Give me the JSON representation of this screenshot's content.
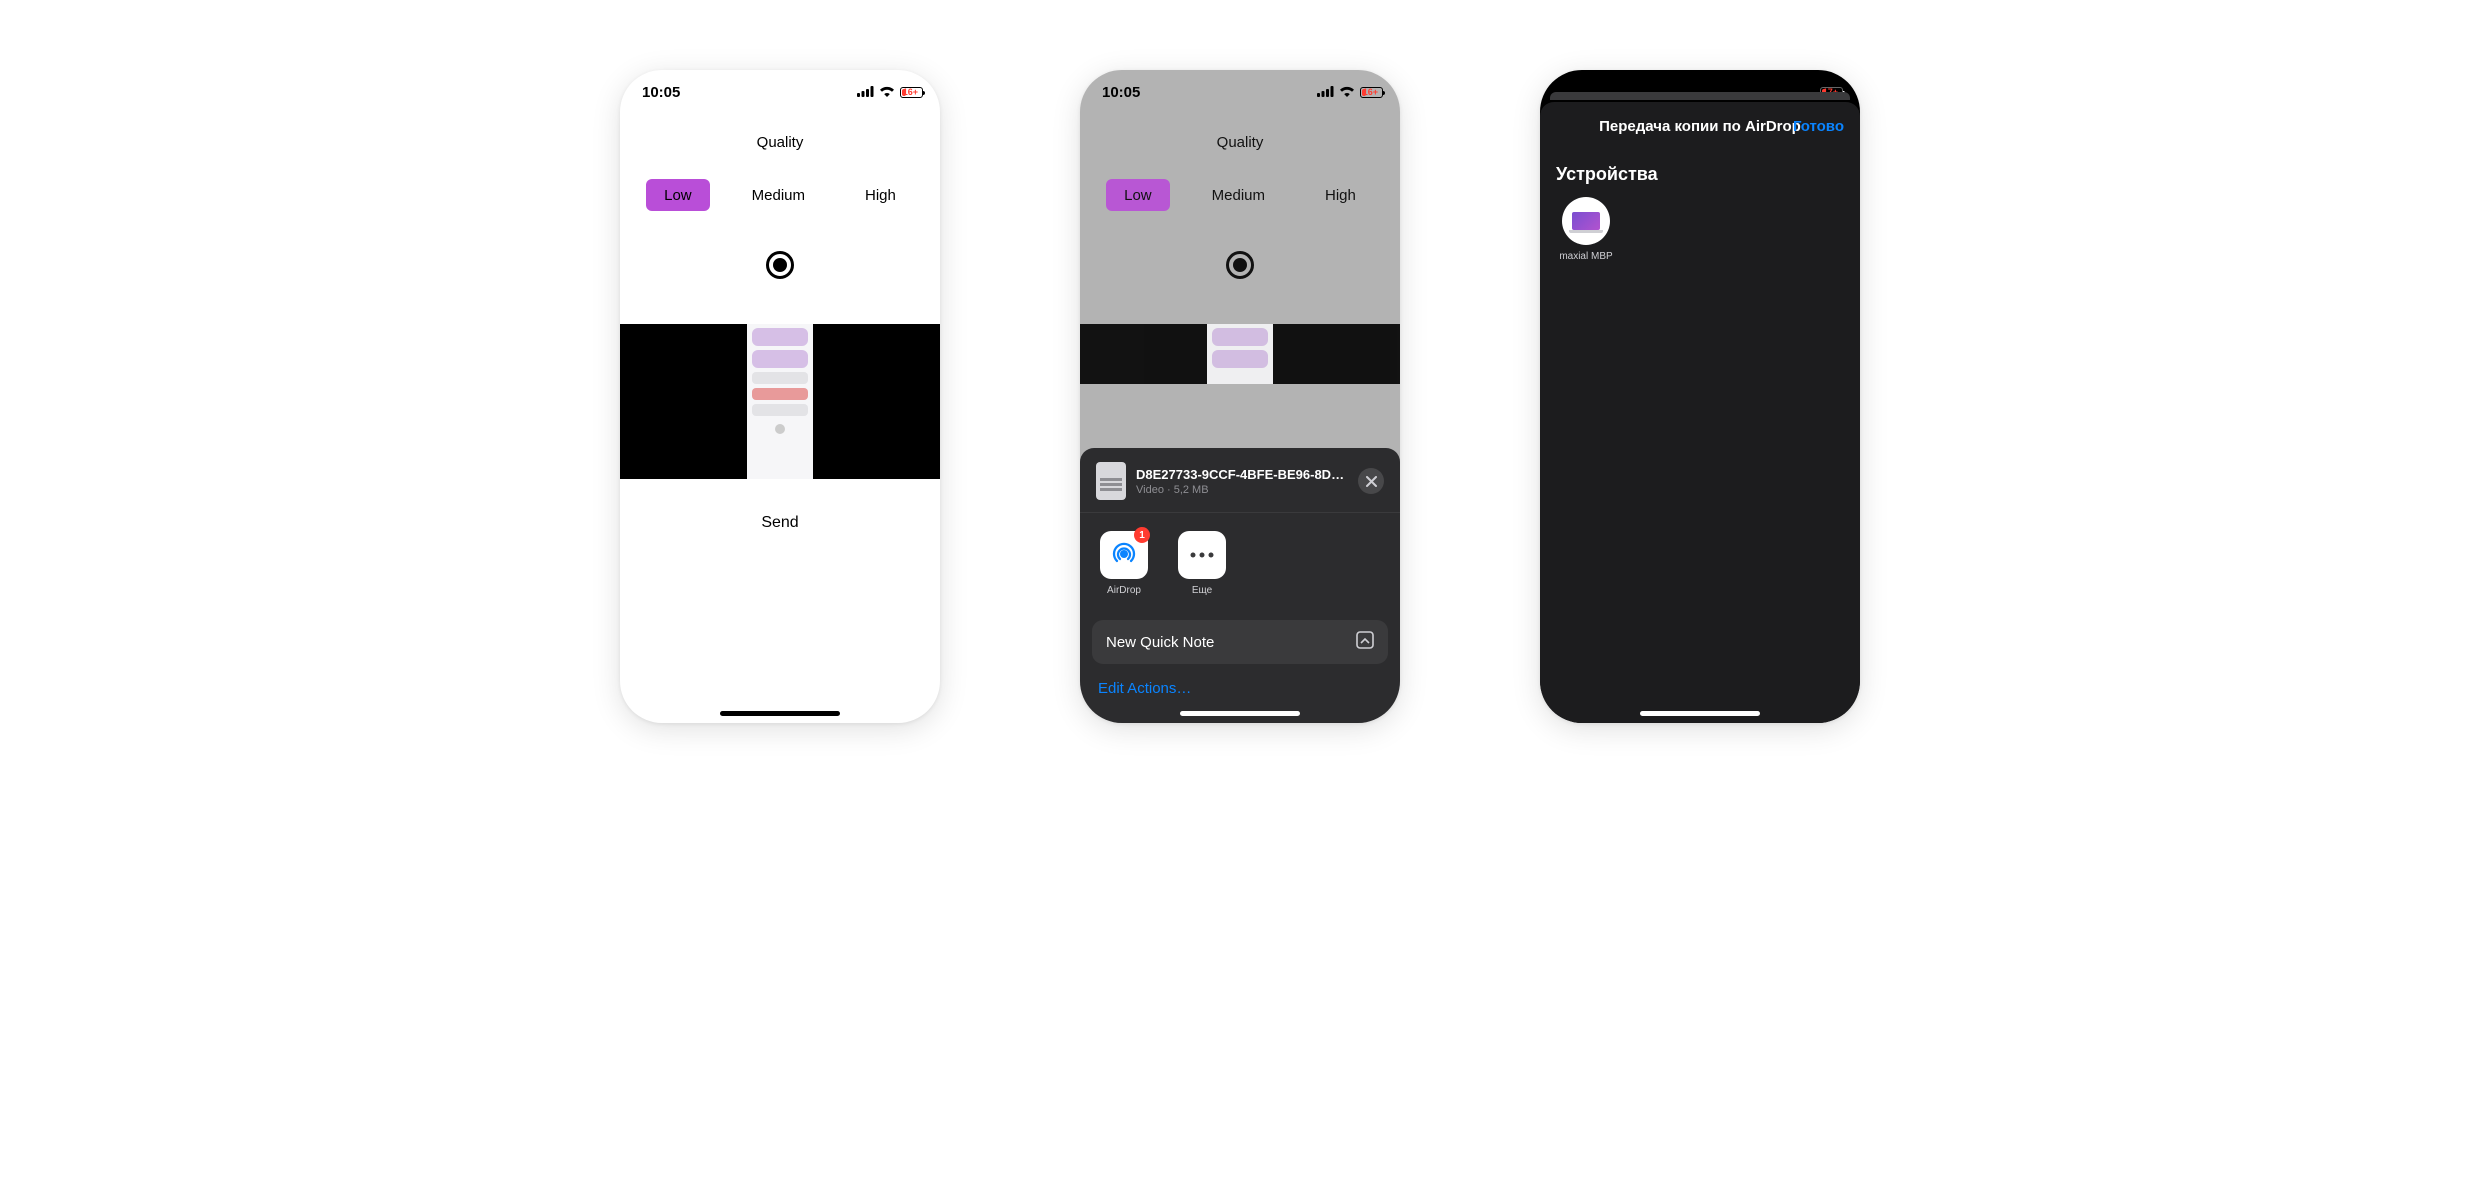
{
  "status": {
    "time": "10:05",
    "battery1": "16+",
    "battery2": "16+",
    "battery3": "17+"
  },
  "quality": {
    "title": "Quality",
    "options": [
      "Low",
      "Medium",
      "High"
    ],
    "selected": 0,
    "send": "Send"
  },
  "share": {
    "file_name": "D8E27733-9CCF-4BFE-BE96-8DB…",
    "file_meta": "Video · 5,2 MB",
    "apps": [
      {
        "label": "AirDrop",
        "badge": "1"
      },
      {
        "label": "Еще"
      }
    ],
    "quick_note": "New Quick Note",
    "edit_actions": "Edit Actions…"
  },
  "airdrop": {
    "title": "Передача копии по AirDrop",
    "done": "Готово",
    "section": "Устройства",
    "device_name": "maxial MBP"
  }
}
